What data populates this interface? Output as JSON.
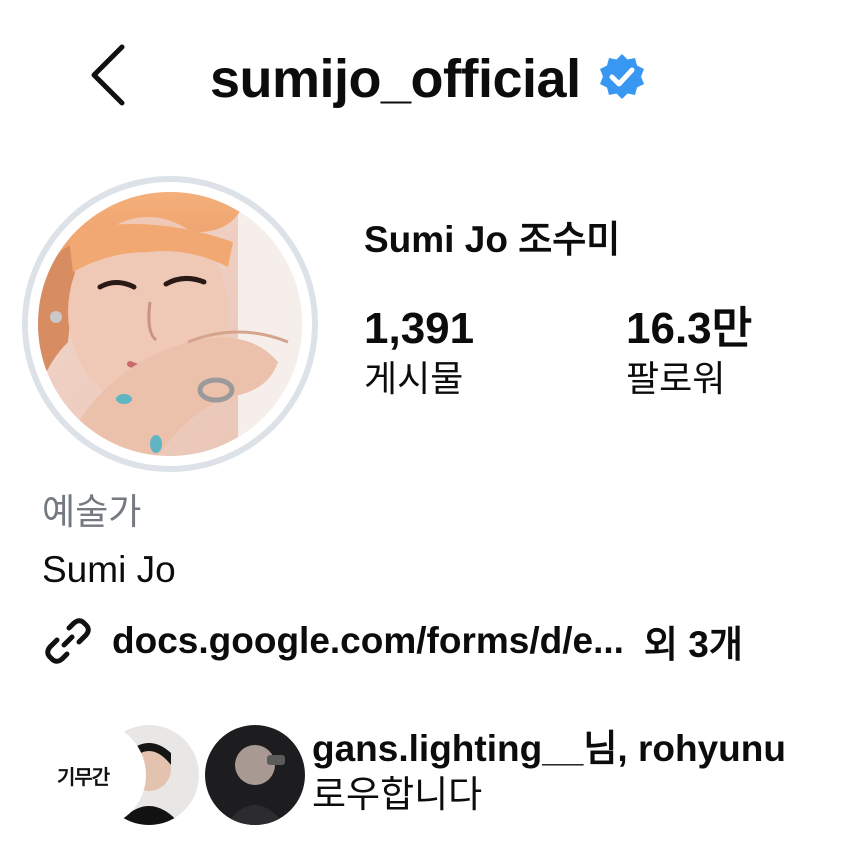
{
  "header": {
    "username": "sumijo_official",
    "verified": true,
    "verified_color": "#3897f0",
    "back_icon": "chevron-left-icon"
  },
  "profile": {
    "display_name": "Sumi Jo 조수미",
    "stats": [
      {
        "value": "1,391",
        "label": "게시물"
      },
      {
        "value": "16.3만",
        "label": "팔로워"
      }
    ]
  },
  "bio": {
    "category": "예술가",
    "name": "Sumi Jo",
    "link_icon": "link-icon",
    "link": "docs.google.com/forms/d/e...",
    "link_more": "외 3개"
  },
  "followed_by": {
    "names": "gans.lighting__님, rohyunu",
    "suffix": "로우합니다",
    "avatar1_text": "기무간"
  }
}
